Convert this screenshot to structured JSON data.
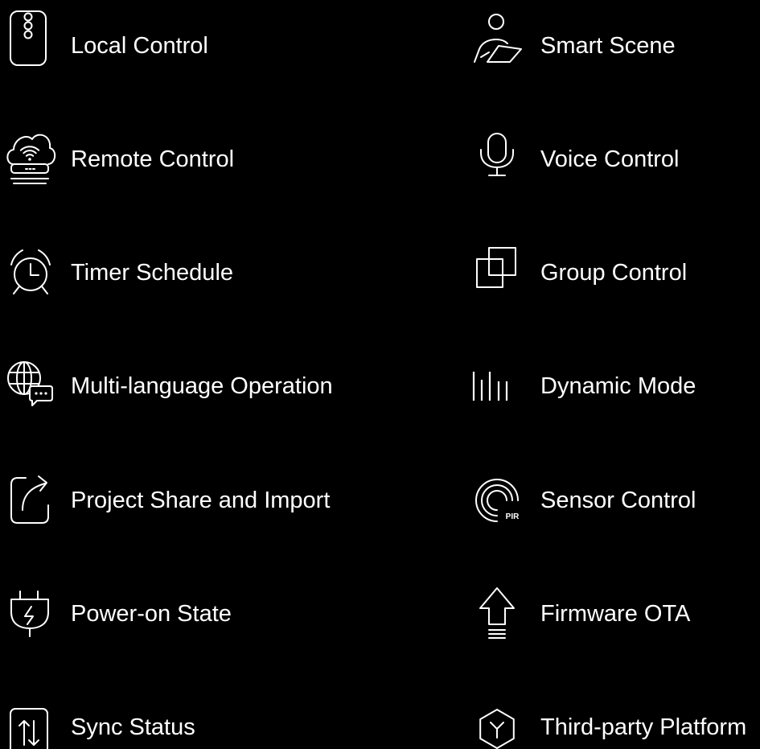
{
  "page": {
    "background": "#000000",
    "foreground": "#ffffff"
  },
  "columns": [
    {
      "items": [
        {
          "label": "Local Control",
          "icon": "remote-icon"
        },
        {
          "label": "Remote Control",
          "icon": "cloud-router-icon"
        },
        {
          "label": "Timer Schedule",
          "icon": "alarm-clock-icon"
        },
        {
          "label": "Multi-language Operation",
          "icon": "globe-chat-icon"
        },
        {
          "label": "Project Share and Import",
          "icon": "share-icon"
        },
        {
          "label": "Power-on State",
          "icon": "power-plug-icon"
        },
        {
          "label": "Sync Status",
          "icon": "sync-arrows-icon"
        }
      ]
    },
    {
      "items": [
        {
          "label": "Smart Scene",
          "icon": "person-scene-icon"
        },
        {
          "label": "Voice Control",
          "icon": "microphone-icon"
        },
        {
          "label": "Group Control",
          "icon": "overlapping-squares-icon"
        },
        {
          "label": "Dynamic Mode",
          "icon": "bars-icon"
        },
        {
          "label": "Sensor Control",
          "icon": "pir-sensor-icon",
          "icon_text": "PIR"
        },
        {
          "label": "Firmware OTA",
          "icon": "upload-arrow-icon"
        },
        {
          "label": "Third-party Platform",
          "icon": "hexagon-y-icon"
        }
      ]
    }
  ]
}
